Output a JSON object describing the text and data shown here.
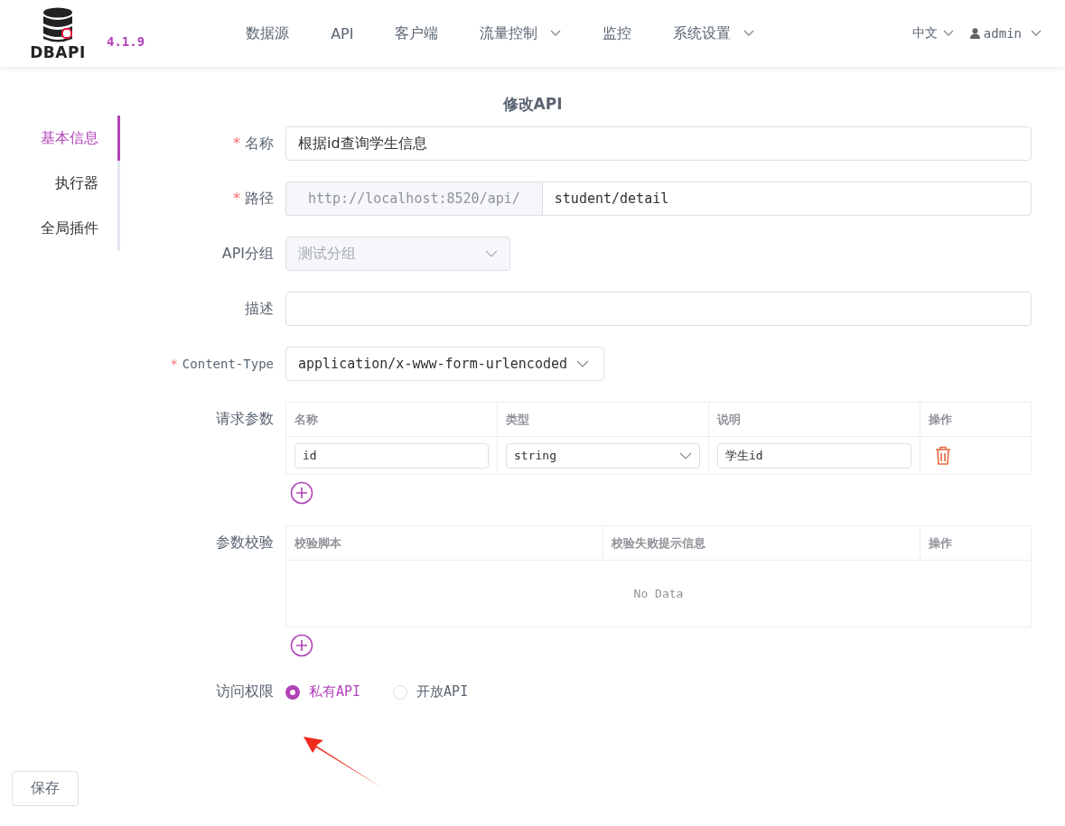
{
  "header": {
    "logo_text": "DBAPI",
    "version": "4.1.9",
    "nav": [
      {
        "label": "数据源",
        "dropdown": false
      },
      {
        "label": "API",
        "dropdown": false
      },
      {
        "label": "客户端",
        "dropdown": false
      },
      {
        "label": "流量控制",
        "dropdown": true
      },
      {
        "label": "监控",
        "dropdown": false
      },
      {
        "label": "系统设置",
        "dropdown": true
      }
    ],
    "language": "中文",
    "user": "admin"
  },
  "page_title": "修改API",
  "sidebar": {
    "items": [
      {
        "label": "基本信息",
        "selected": true
      },
      {
        "label": "执行器",
        "selected": false
      },
      {
        "label": "全局插件",
        "selected": false
      }
    ]
  },
  "form": {
    "name": {
      "label": "名称",
      "required_mark": "*",
      "value": "根据id查询学生信息"
    },
    "path": {
      "label": "路径",
      "required_mark": "*",
      "prefix": "http://localhost:8520/api/",
      "value": "student/detail"
    },
    "group": {
      "label": "API分组",
      "value": "测试分组",
      "disabled": true
    },
    "description": {
      "label": "描述"
    },
    "content_type": {
      "label": "Content-Type",
      "required_mark": "*",
      "value": "application/x-www-form-urlencoded"
    },
    "params": {
      "label": "请求参数",
      "columns": [
        "名称",
        "类型",
        "说明",
        "操作"
      ],
      "rows": [
        {
          "name": "id",
          "type": "string",
          "note": "学生id"
        }
      ]
    },
    "validation": {
      "label": "参数校验",
      "columns": [
        "校验脚本",
        "校验失败提示信息",
        "操作"
      ],
      "empty_text": "No Data"
    },
    "access": {
      "label": "访问权限",
      "options": [
        {
          "label": "私有API",
          "selected": true
        },
        {
          "label": "开放API",
          "selected": false
        }
      ]
    }
  },
  "save_button": "保存"
}
